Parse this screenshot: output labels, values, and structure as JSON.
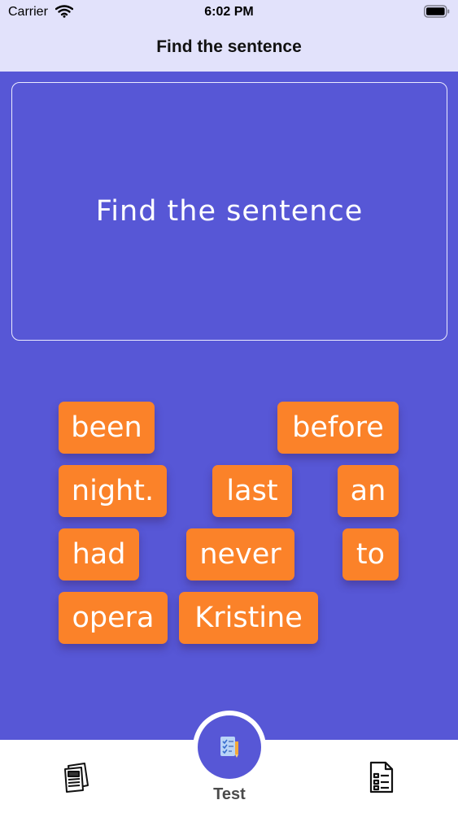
{
  "status_bar": {
    "carrier": "Carrier",
    "time": "6:02 PM"
  },
  "nav": {
    "title": "Find the sentence"
  },
  "prompt": {
    "text": "Find the sentence"
  },
  "words": [
    "been",
    "before",
    "night.",
    "last",
    "an",
    "had",
    "never",
    "to",
    "opera",
    "Kristine"
  ],
  "tab_bar": {
    "center_label": "Test"
  },
  "colors": {
    "background": "#5757d6",
    "tile": "#fb8229",
    "bar": "#e2e2fb"
  }
}
